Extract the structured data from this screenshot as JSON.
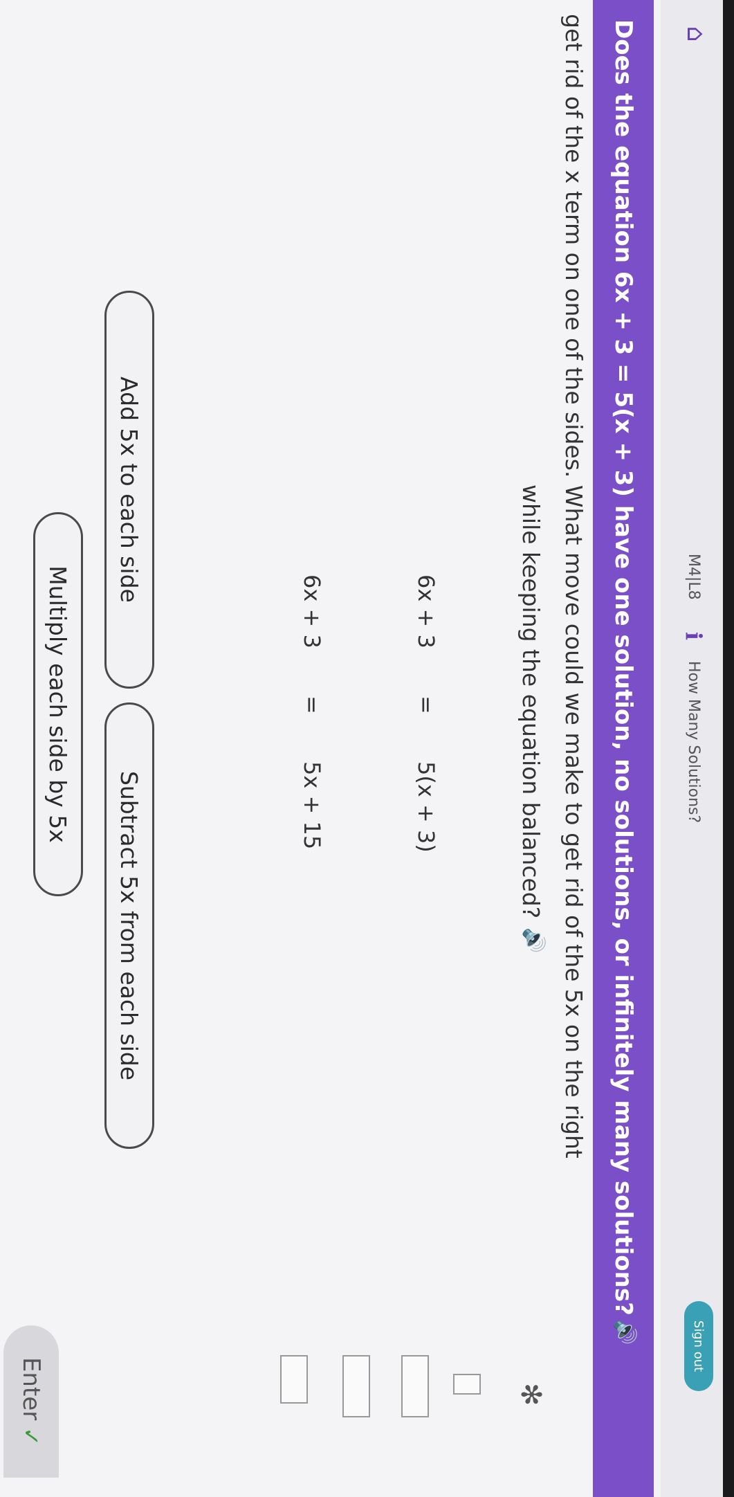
{
  "header": {
    "lesson_code": "M4|L8",
    "lesson_title": "How Many Solutions?",
    "sign_out_label": "Sign out"
  },
  "question": {
    "text": "Does the equation 6x + 3 = 5(x + 3) have one solution, no solutions, or infinitely many solutions?"
  },
  "instruction": {
    "line1": "get rid of the x term on one of the sides. What move could we make to get rid of the 5x on the right",
    "line2": "while keeping the equation balanced?"
  },
  "equations": [
    {
      "left": "6x + 3",
      "eq": "=",
      "right": "5(x + 3)"
    },
    {
      "left": "6x + 3",
      "eq": "=",
      "right": "5x + 15"
    }
  ],
  "choices": {
    "add": "Add 5x to each side",
    "subtract": "Subtract 5x from each side",
    "multiply": "Multiply each side by 5x"
  },
  "enter": {
    "label": "Enter",
    "check": "✓"
  },
  "icons": {
    "home": "home-icon",
    "info": "info-icon",
    "audio": "speaker-icon",
    "settings": "gear-icon"
  },
  "colors": {
    "banner": "#7a4fc8",
    "sign_out": "#3aa0b5",
    "accent": "#6a3fb2"
  }
}
